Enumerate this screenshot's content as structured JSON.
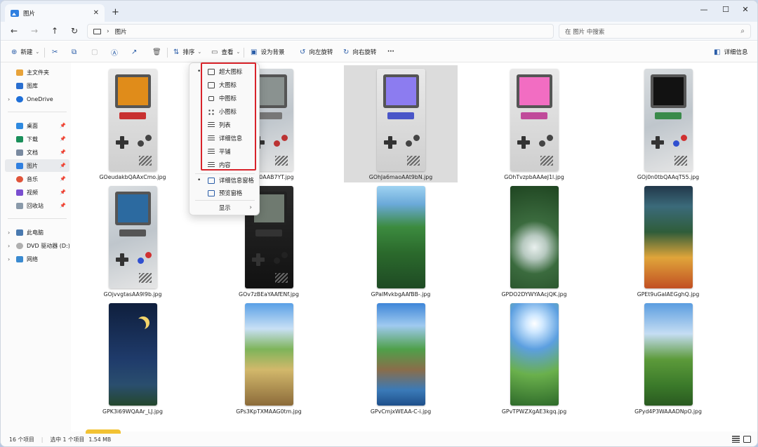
{
  "tab": {
    "title": "图片",
    "close": "✕",
    "add": "+"
  },
  "window_controls": {
    "minimize": "—",
    "maximize": "☐",
    "close": "✕"
  },
  "nav": {
    "back": "←",
    "forward": "→",
    "up": "↑",
    "refresh": "↻"
  },
  "address": {
    "separator": "›",
    "path": "图片"
  },
  "search": {
    "placeholder": "在 图片 中搜索",
    "icon": "⌕"
  },
  "toolbar": {
    "new": "新建",
    "sort": "排序",
    "view": "查看",
    "set_background": "设为背景",
    "rotate_left": "向左旋转",
    "rotate_right": "向右旋转",
    "more": "···",
    "details": "详细信息"
  },
  "sidebar": {
    "top": [
      {
        "label": "主文件夹",
        "color": "#e8a33a"
      },
      {
        "label": "图库",
        "color": "#2a6fd0"
      },
      {
        "label": "OneDrive",
        "color": "#1f6fd8"
      }
    ],
    "pinned": [
      {
        "label": "桌面",
        "color": "#2f8ae0"
      },
      {
        "label": "下载",
        "color": "#1a8f5a"
      },
      {
        "label": "文档",
        "color": "#7a8aa0"
      },
      {
        "label": "图片",
        "color": "#2f7fe0"
      },
      {
        "label": "音乐",
        "color": "#e0543a"
      },
      {
        "label": "视频",
        "color": "#7a4fd0"
      },
      {
        "label": "回收站",
        "color": "#8a9aaa"
      }
    ],
    "devices": [
      {
        "label": "此电脑",
        "color": "#4a7ab0"
      },
      {
        "label": "DVD 驱动器 (D:) E",
        "color": "#b0b0b0"
      },
      {
        "label": "网络",
        "color": "#3a8ad0"
      }
    ]
  },
  "view_menu": {
    "items": [
      {
        "label": "超大图标",
        "selected": true,
        "icon": "extra-large-icons-icon"
      },
      {
        "label": "大图标",
        "selected": false,
        "icon": "large-icons-icon"
      },
      {
        "label": "中图标",
        "selected": false,
        "icon": "medium-icons-icon"
      },
      {
        "label": "小图标",
        "selected": false,
        "icon": "small-icons-icon"
      },
      {
        "label": "列表",
        "selected": false,
        "icon": "list-icon"
      },
      {
        "label": "详细信息",
        "selected": false,
        "icon": "details-icon"
      },
      {
        "label": "平铺",
        "selected": false,
        "icon": "tiles-icon"
      },
      {
        "label": "内容",
        "selected": false,
        "icon": "content-icon"
      }
    ],
    "panes": [
      {
        "label": "详细信息窗格",
        "selected": true,
        "icon": "details-pane-icon"
      },
      {
        "label": "预览窗格",
        "selected": false,
        "icon": "preview-pane-icon"
      }
    ],
    "show": "显示",
    "bullet": "•",
    "submenu_arrow": "›"
  },
  "files": [
    "GOeudakbQAAxCmo.jpg",
    "GO9a0AAB7YT.jpg",
    "GOhJa6maoAAt9bN.jpg",
    "GOhTvzpbAAAeJ1l.jpg",
    "GOj0n0tbQAAqT55.jpg",
    "GOjvvgtasAA9l9b.jpg",
    "GOv7zBEaYAAfENf.jpg",
    "GPaIMvkbgAAfBB-.jpg",
    "GPDO2DYWYAAcjQK.jpg",
    "GPEt9uGaIAEGghQ.jpg",
    "GPK3i69WQAAr_LJ.jpg",
    "GPs3KpTXMAAG0tm.jpg",
    "GPvCmjxWEAA-C-i.jpg",
    "GPvTPWZXgAE3kgq.jpg",
    "GPyd4P3WAAADNpO.jpg"
  ],
  "status": {
    "count": "16 个项目",
    "selected": "选中 1 个项目",
    "size": "1.54 MB"
  },
  "colors": {
    "accent": "#2a5da8",
    "highlight": "#d8232a",
    "selection": "#dcdcdc"
  }
}
